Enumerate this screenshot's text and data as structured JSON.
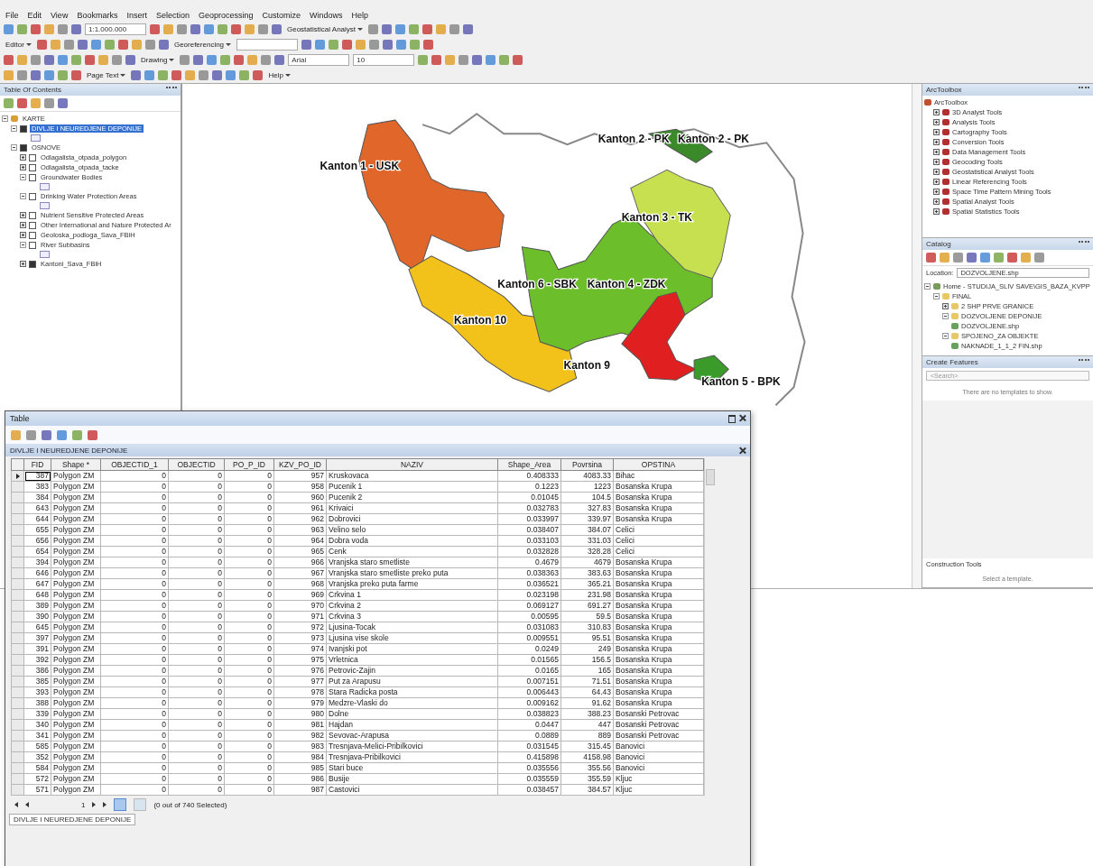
{
  "menu": [
    "File",
    "Edit",
    "View",
    "Bookmarks",
    "Insert",
    "Selection",
    "Geoprocessing",
    "Customize",
    "Windows",
    "Help"
  ],
  "toolbars": [
    {
      "items": [
        {
          "kind": "icons"
        },
        {
          "kind": "field",
          "value": "1:1.000.000"
        },
        {
          "kind": "icons"
        },
        {
          "kind": "menu",
          "label": "Geostatistical Analyst"
        },
        {
          "kind": "icons"
        }
      ]
    },
    {
      "items": [
        {
          "kind": "menu",
          "label": "Editor"
        },
        {
          "kind": "icons"
        },
        {
          "kind": "menu",
          "label": "Georeferencing"
        },
        {
          "kind": "field"
        },
        {
          "kind": "icons"
        }
      ]
    },
    {
      "items": [
        {
          "kind": "icons"
        },
        {
          "kind": "menu",
          "label": "Drawing"
        },
        {
          "kind": "icons"
        },
        {
          "kind": "field",
          "value": "Arial"
        },
        {
          "kind": "field",
          "value": "10"
        },
        {
          "kind": "icons"
        }
      ]
    },
    {
      "items": [
        {
          "kind": "icons"
        },
        {
          "kind": "menu",
          "label": "Page Text"
        },
        {
          "kind": "icons"
        },
        {
          "kind": "menu",
          "label": "Help"
        }
      ]
    }
  ],
  "toc": {
    "title": "Table Of Contents",
    "items": [
      {
        "label": "KARTE",
        "kind": "frame",
        "expanded": true,
        "selected": false,
        "children": [
          {
            "label": "DIVLJE I NEUREDJENE DEPONIJE",
            "kind": "layer",
            "expanded": true,
            "checked": true,
            "selected": true
          },
          {
            "label": "OSNOVE",
            "kind": "group",
            "expanded": true,
            "checked": true,
            "selected": false,
            "children": [
              {
                "label": "Odlagalista_otpada_polygon",
                "kind": "layer",
                "expanded": false,
                "checked": false,
                "selected": false
              },
              {
                "label": "Odlagalista_otpada_tacke",
                "kind": "layer",
                "expanded": false,
                "checked": false,
                "selected": false
              },
              {
                "label": "Groundwater Bodies",
                "kind": "layer",
                "expanded": true,
                "checked": false,
                "selected": false
              },
              {
                "label": "Drinking Water Protection Areas",
                "kind": "layer",
                "expanded": true,
                "checked": false,
                "selected": false
              },
              {
                "label": "Nutrient Sensitive Protected Areas",
                "kind": "layer",
                "expanded": false,
                "checked": false,
                "selected": false
              },
              {
                "label": "Other International and Nature Protected Ar",
                "kind": "layer",
                "expanded": false,
                "checked": false,
                "selected": false
              },
              {
                "label": "Geoloska_podloga_Sava_FBiH",
                "kind": "layer",
                "expanded": false,
                "checked": false,
                "selected": false
              },
              {
                "label": "River Subbasins",
                "kind": "layer",
                "expanded": true,
                "checked": false,
                "selected": false
              },
              {
                "label": "Kantoni_Sava_FBiH",
                "kind": "layer",
                "expanded": false,
                "checked": true,
                "selected": false
              }
            ]
          }
        ]
      }
    ]
  },
  "map": {
    "labels": [
      "Kanton 2 - PK",
      "Kanton 2 - PK",
      "Kanton 1 - USK",
      "Kanton 3 - TK",
      "Kanton 6 - SBK",
      "Kanton 4 - ZDK",
      "Kanton 10",
      "Kanton 9",
      "Kanton 5 - BPK"
    ]
  },
  "arctoolbox": {
    "title": "ArcToolbox",
    "root": "ArcToolbox",
    "items": [
      "3D Analyst Tools",
      "Analysis Tools",
      "Cartography Tools",
      "Conversion Tools",
      "Data Management Tools",
      "Geocoding Tools",
      "Geostatistical Analyst Tools",
      "Linear Referencing Tools",
      "Space Time Pattern Mining Tools",
      "Spatial Analyst Tools",
      "Spatial Statistics Tools"
    ]
  },
  "catalog": {
    "title": "Catalog",
    "location_label": "Location:",
    "location": "DOZVOLJENE.shp",
    "tree": [
      {
        "label": "Home - STUDIJA_SLIV SAVE\\GIS_BAZA_KVPP",
        "kind": "home",
        "expanded": true,
        "children": [
          {
            "label": "FINAL",
            "kind": "folder",
            "expanded": true,
            "children": [
              {
                "label": "2 SHP PRVE GRANICE",
                "kind": "folder",
                "expanded": false
              },
              {
                "label": "DOZVOLJENE DEPONIJE",
                "kind": "folder",
                "expanded": true,
                "children": [
                  {
                    "label": "DOZVOLJENE.shp",
                    "kind": "file"
                  }
                ]
              },
              {
                "label": "SPOJENO_ZA OBJEKTE",
                "kind": "folder",
                "expanded": true,
                "children": [
                  {
                    "label": "NAKNADE_1_1_2 FIN.shp",
                    "kind": "file"
                  }
                ]
              }
            ]
          }
        ]
      }
    ]
  },
  "create_features": {
    "title": "Create Features",
    "search_placeholder": "<Search>",
    "empty_message": "There are no templates to show.",
    "construction_title": "Construction Tools",
    "construction_message": "Select a template."
  },
  "table": {
    "title": "Table",
    "layer": "DIVLJE I NEUREDJENE DEPONIJE",
    "columns": [
      {
        "label": "FID",
        "kind": "number"
      },
      {
        "label": "Shape *",
        "kind": "text"
      },
      {
        "label": "OBJECTID_1",
        "kind": "number"
      },
      {
        "label": "OBJECTID",
        "kind": "number"
      },
      {
        "label": "PO_P_ID",
        "kind": "number"
      },
      {
        "label": "KZV_PO_ID",
        "kind": "number"
      },
      {
        "label": "NAZIV",
        "kind": "text"
      },
      {
        "label": "Shape_Area",
        "kind": "number"
      },
      {
        "label": "Povrsina",
        "kind": "number"
      },
      {
        "label": "OPSTINA",
        "kind": "text"
      }
    ],
    "rows": [
      {
        "current": true,
        "cells": [
          "387",
          "Polygon ZM",
          "0",
          "0",
          "0",
          "957",
          "Kruskovaca",
          "0.408333",
          "4083.33",
          "Bihac"
        ]
      },
      {
        "current": false,
        "cells": [
          "383",
          "Polygon ZM",
          "0",
          "0",
          "0",
          "958",
          "Pucenik 1",
          "0.1223",
          "1223",
          "Bosanska Krupa"
        ]
      },
      {
        "current": false,
        "cells": [
          "384",
          "Polygon ZM",
          "0",
          "0",
          "0",
          "960",
          "Pucenik 2",
          "0.01045",
          "104.5",
          "Bosanska Krupa"
        ]
      },
      {
        "current": false,
        "cells": [
          "643",
          "Polygon ZM",
          "0",
          "0",
          "0",
          "961",
          "Krivaici",
          "0.032783",
          "327.83",
          "Bosanska Krupa"
        ]
      },
      {
        "current": false,
        "cells": [
          "644",
          "Polygon ZM",
          "0",
          "0",
          "0",
          "962",
          "Dobrovici",
          "0.033997",
          "339.97",
          "Bosanska Krupa"
        ]
      },
      {
        "current": false,
        "cells": [
          "655",
          "Polygon ZM",
          "0",
          "0",
          "0",
          "963",
          "Velino selo",
          "0.038407",
          "384.07",
          "Celici"
        ]
      },
      {
        "current": false,
        "cells": [
          "656",
          "Polygon ZM",
          "0",
          "0",
          "0",
          "964",
          "Dobra voda",
          "0.033103",
          "331.03",
          "Celici"
        ]
      },
      {
        "current": false,
        "cells": [
          "654",
          "Polygon ZM",
          "0",
          "0",
          "0",
          "965",
          "Cenk",
          "0.032828",
          "328.28",
          "Celici"
        ]
      },
      {
        "current": false,
        "cells": [
          "394",
          "Polygon ZM",
          "0",
          "0",
          "0",
          "966",
          "Vranjska staro smetliste",
          "0.4679",
          "4679",
          "Bosanska Krupa"
        ]
      },
      {
        "current": false,
        "cells": [
          "646",
          "Polygon ZM",
          "0",
          "0",
          "0",
          "967",
          "Vranjska staro smetliste preko puta",
          "0.038363",
          "383.63",
          "Bosanska Krupa"
        ]
      },
      {
        "current": false,
        "cells": [
          "647",
          "Polygon ZM",
          "0",
          "0",
          "0",
          "968",
          "Vranjska preko puta farme",
          "0.036521",
          "365.21",
          "Bosanska Krupa"
        ]
      },
      {
        "current": false,
        "cells": [
          "648",
          "Polygon ZM",
          "0",
          "0",
          "0",
          "969",
          "Crkvina 1",
          "0.023198",
          "231.98",
          "Bosanska Krupa"
        ]
      },
      {
        "current": false,
        "cells": [
          "389",
          "Polygon ZM",
          "0",
          "0",
          "0",
          "970",
          "Crkvina 2",
          "0.069127",
          "691.27",
          "Bosanska Krupa"
        ]
      },
      {
        "current": false,
        "cells": [
          "390",
          "Polygon ZM",
          "0",
          "0",
          "0",
          "971",
          "Crkvina 3",
          "0.00595",
          "59.5",
          "Bosanska Krupa"
        ]
      },
      {
        "current": false,
        "cells": [
          "645",
          "Polygon ZM",
          "0",
          "0",
          "0",
          "972",
          "Ljusina-Tocak",
          "0.031083",
          "310.83",
          "Bosanska Krupa"
        ]
      },
      {
        "current": false,
        "cells": [
          "397",
          "Polygon ZM",
          "0",
          "0",
          "0",
          "973",
          "Ljusina vise skole",
          "0.009551",
          "95.51",
          "Bosanska Krupa"
        ]
      },
      {
        "current": false,
        "cells": [
          "391",
          "Polygon ZM",
          "0",
          "0",
          "0",
          "974",
          "Ivanjski pot",
          "0.0249",
          "249",
          "Bosanska Krupa"
        ]
      },
      {
        "current": false,
        "cells": [
          "392",
          "Polygon ZM",
          "0",
          "0",
          "0",
          "975",
          "Vrletnica",
          "0.01565",
          "156.5",
          "Bosanska Krupa"
        ]
      },
      {
        "current": false,
        "cells": [
          "386",
          "Polygon ZM",
          "0",
          "0",
          "0",
          "976",
          "Petrovic-Zajin",
          "0.0165",
          "165",
          "Bosanska Krupa"
        ]
      },
      {
        "current": false,
        "cells": [
          "385",
          "Polygon ZM",
          "0",
          "0",
          "0",
          "977",
          "Put za Arapusu",
          "0.007151",
          "71.51",
          "Bosanska Krupa"
        ]
      },
      {
        "current": false,
        "cells": [
          "393",
          "Polygon ZM",
          "0",
          "0",
          "0",
          "978",
          "Stara Radicka posta",
          "0.006443",
          "64.43",
          "Bosanska Krupa"
        ]
      },
      {
        "current": false,
        "cells": [
          "388",
          "Polygon ZM",
          "0",
          "0",
          "0",
          "979",
          "Medzre-Vlaski do",
          "0.009162",
          "91.62",
          "Bosanska Krupa"
        ]
      },
      {
        "current": false,
        "cells": [
          "339",
          "Polygon ZM",
          "0",
          "0",
          "0",
          "980",
          "Dolne",
          "0.038823",
          "388.23",
          "Bosanski Petrovac"
        ]
      },
      {
        "current": false,
        "cells": [
          "340",
          "Polygon ZM",
          "0",
          "0",
          "0",
          "981",
          "Hajdan",
          "0.0447",
          "447",
          "Bosanski Petrovac"
        ]
      },
      {
        "current": false,
        "cells": [
          "341",
          "Polygon ZM",
          "0",
          "0",
          "0",
          "982",
          "Sevovac-Arapusa",
          "0.0889",
          "889",
          "Bosanski Petrovac"
        ]
      },
      {
        "current": false,
        "cells": [
          "585",
          "Polygon ZM",
          "0",
          "0",
          "0",
          "983",
          "Tresnjava-Melici-Pribilkovici",
          "0.031545",
          "315.45",
          "Banovici"
        ]
      },
      {
        "current": false,
        "cells": [
          "352",
          "Polygon ZM",
          "0",
          "0",
          "0",
          "984",
          "Tresnjava-Pribilkovici",
          "0.415898",
          "4158.98",
          "Banovici"
        ]
      },
      {
        "current": false,
        "cells": [
          "584",
          "Polygon ZM",
          "0",
          "0",
          "0",
          "985",
          "Stari buce",
          "0.035556",
          "355.56",
          "Banovici"
        ]
      },
      {
        "current": false,
        "cells": [
          "572",
          "Polygon ZM",
          "0",
          "0",
          "0",
          "986",
          "Busije",
          "0.035559",
          "355.59",
          "Kljuc"
        ]
      },
      {
        "current": false,
        "cells": [
          "571",
          "Polygon ZM",
          "0",
          "0",
          "0",
          "987",
          "Castovici",
          "0.038457",
          "384.57",
          "Kljuc"
        ]
      }
    ],
    "page": "1",
    "status": "(0 out of 740 Selected)",
    "views": [
      {
        "selected": true
      },
      {
        "selected": false
      }
    ],
    "tab": "DIVLJE I NEUREDJENE DEPONIJE"
  }
}
